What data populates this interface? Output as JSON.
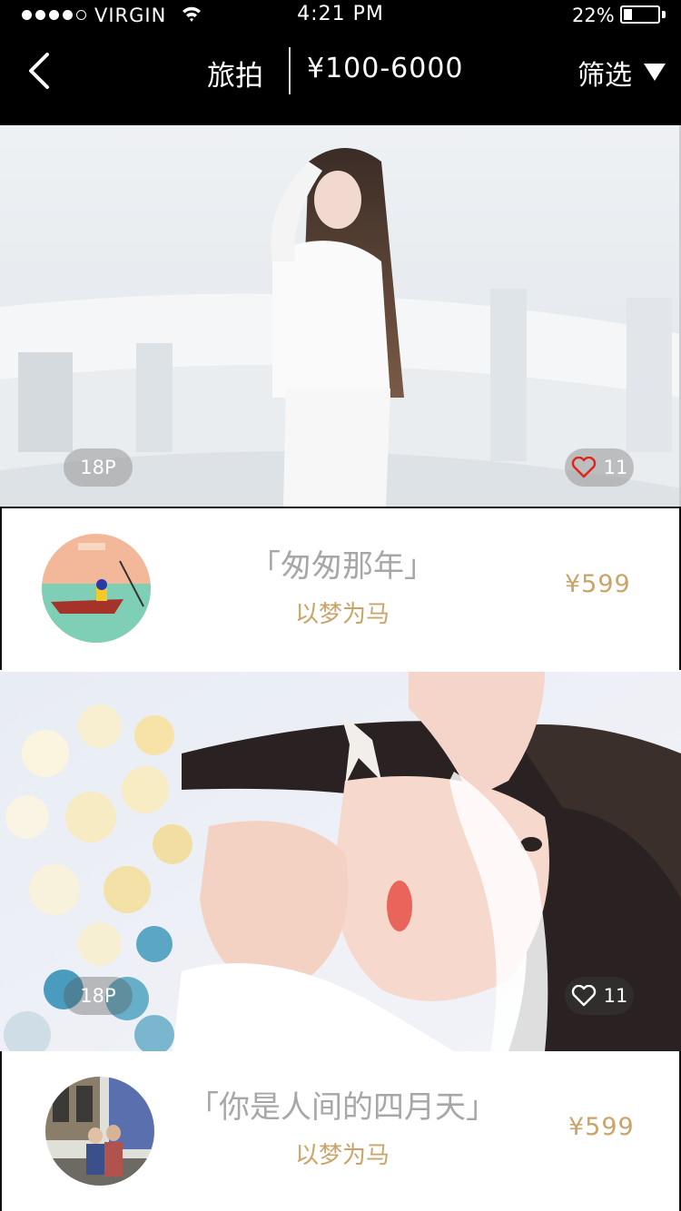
{
  "status_bar": {
    "carrier": "VIRGIN",
    "time": "4:21 PM",
    "battery": "22%"
  },
  "nav": {
    "back_icon": "chevron-left-icon",
    "title": "旅拍",
    "price_range": "¥100-6000",
    "filter_label": "筛选",
    "filter_icon": "triangle-down-icon"
  },
  "cards": [
    {
      "pages": "18P",
      "likes": "11",
      "liked": true,
      "title": "「匆匆那年」",
      "author": "以梦为马",
      "price": "¥599"
    },
    {
      "pages": "18P",
      "likes": "11",
      "liked": false,
      "title": "「你是人间的四月天」",
      "author": "以梦为马",
      "price": "¥599"
    }
  ],
  "colors": {
    "accent_gold": "#c9a46a",
    "title_gray": "#a7a7a7",
    "like_red": "#e2231a"
  }
}
